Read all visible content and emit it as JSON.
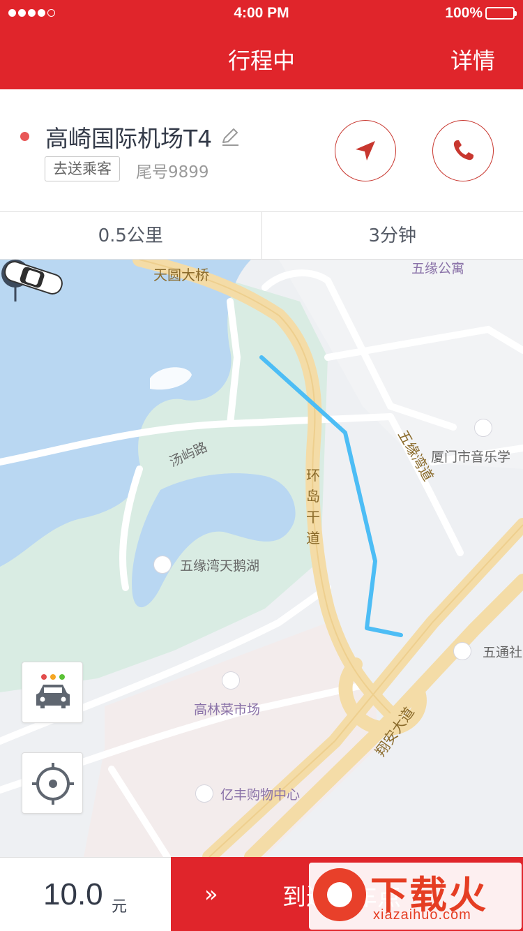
{
  "status_bar": {
    "time": "4:00 PM",
    "battery": "100%"
  },
  "nav": {
    "title": "行程中",
    "detail": "详情"
  },
  "destination": {
    "name": "高崎国际机场T4",
    "tag": "去送乘客",
    "tail_number": "尾号9899"
  },
  "metrics": {
    "distance": "0.5公里",
    "duration": "3分钟"
  },
  "map": {
    "labels": {
      "tianyuan_bridge": "天圆大桥",
      "wuyuan_apartment": "五缘公寓",
      "wuyuanwan_road": "五缘湾道",
      "music_school": "厦门市音乐学",
      "tangyu_road": "汤屿路",
      "huandao_road": "环岛干道",
      "swan_lake": "五缘湾天鹅湖",
      "wutong": "五通社",
      "gaolin_market": "高林菜市场",
      "xiangan_avenue": "翔安大道",
      "yifeng_mall": "亿丰购物中心"
    },
    "colors": {
      "water": "#b9d7f2",
      "park": "#d9ece3",
      "main_road": "#f4dca7",
      "route": "#4dbdf5"
    }
  },
  "bottom": {
    "fare": "10.0",
    "fare_unit": "元",
    "action_arrows": "»",
    "action_label": "到达上车点"
  },
  "watermark": {
    "title": "下载火",
    "domain": "xiazaihuo.com"
  },
  "theme": {
    "brand_red": "#E0252B"
  }
}
